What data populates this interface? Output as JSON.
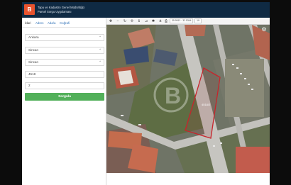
{
  "header": {
    "logo_text": "B",
    "org_line1": "Tapu ve Kadastro Genel Müdürlüğü",
    "org_line2": "Parsel Sorgu Uygulaması"
  },
  "tabs": [
    {
      "label": "İdari"
    },
    {
      "label": "Adres"
    },
    {
      "label": "Ada/a"
    },
    {
      "label": "Coğrafi"
    }
  ],
  "form": {
    "province": "Ankara",
    "district": "Sincan",
    "neighborhood": "Sincan",
    "block": "4518",
    "parcel": "2",
    "submit_label": "Sorgula"
  },
  "map": {
    "coord_readout": "39.9913 · 32.5344",
    "zoom_level": "19",
    "parcel_label": "4518/2"
  },
  "colors": {
    "header_bg": "#0f2a43",
    "logo": "#e8532e",
    "button": "#52b05a",
    "tab_link": "#2d6fb6",
    "parcel_outline": "#c8242b"
  }
}
